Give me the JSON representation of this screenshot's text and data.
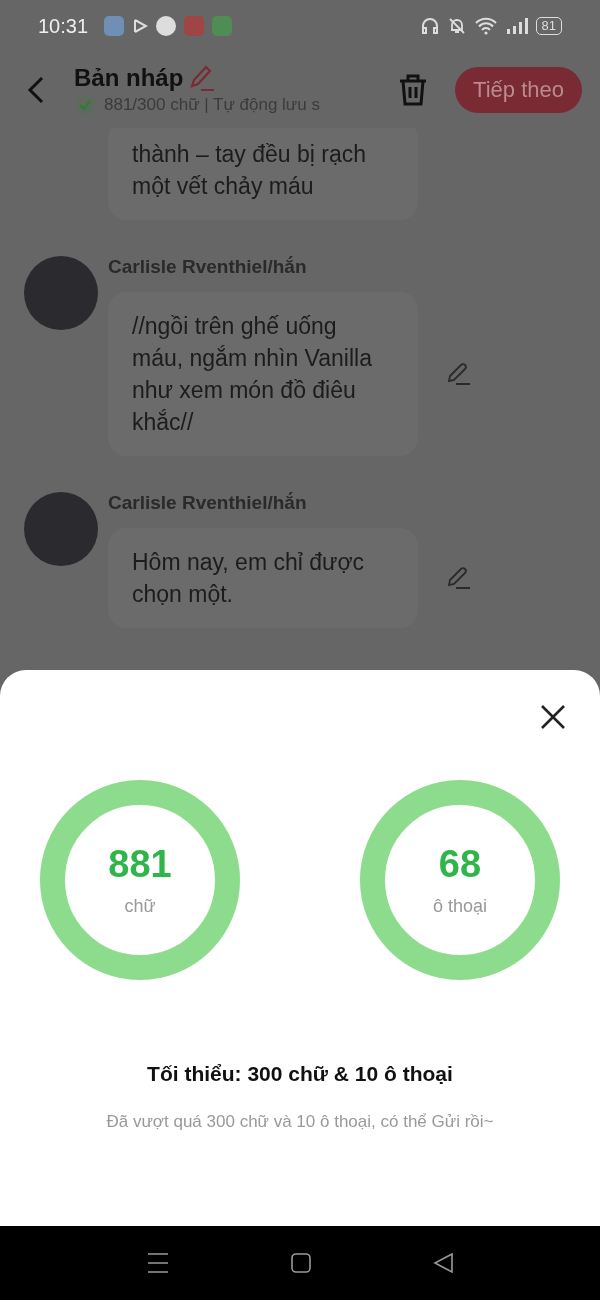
{
  "status_bar": {
    "time": "10:31",
    "battery": "81"
  },
  "header": {
    "title": "Bản nháp",
    "subtitle": "881/300 chữ | Tự động lưu s",
    "next_button": "Tiếp theo"
  },
  "messages": [
    {
      "text": "thành – tay đều bị rạch một vết chảy máu",
      "editable": false
    },
    {
      "speaker": "Carlisle Rventhiel/hắn",
      "text": "//ngồi trên ghế uống máu, ngắm nhìn Vanilla như xem món đồ điêu khắc//",
      "editable": true
    },
    {
      "speaker": "Carlisle Rventhiel/hắn",
      "text": "Hôm nay, em chỉ được chọn một.",
      "editable": true
    }
  ],
  "sheet": {
    "stats": [
      {
        "value": "881",
        "unit": "chữ",
        "level": 1
      },
      {
        "value": "68",
        "unit": "ô thoại",
        "level": 1
      }
    ],
    "minimum": "Tối thiểu: 300 chữ & 10 ô thoại",
    "note": "Đã vượt quá 300 chữ và 10 ô thoại, có thể Gửi rồi~"
  }
}
